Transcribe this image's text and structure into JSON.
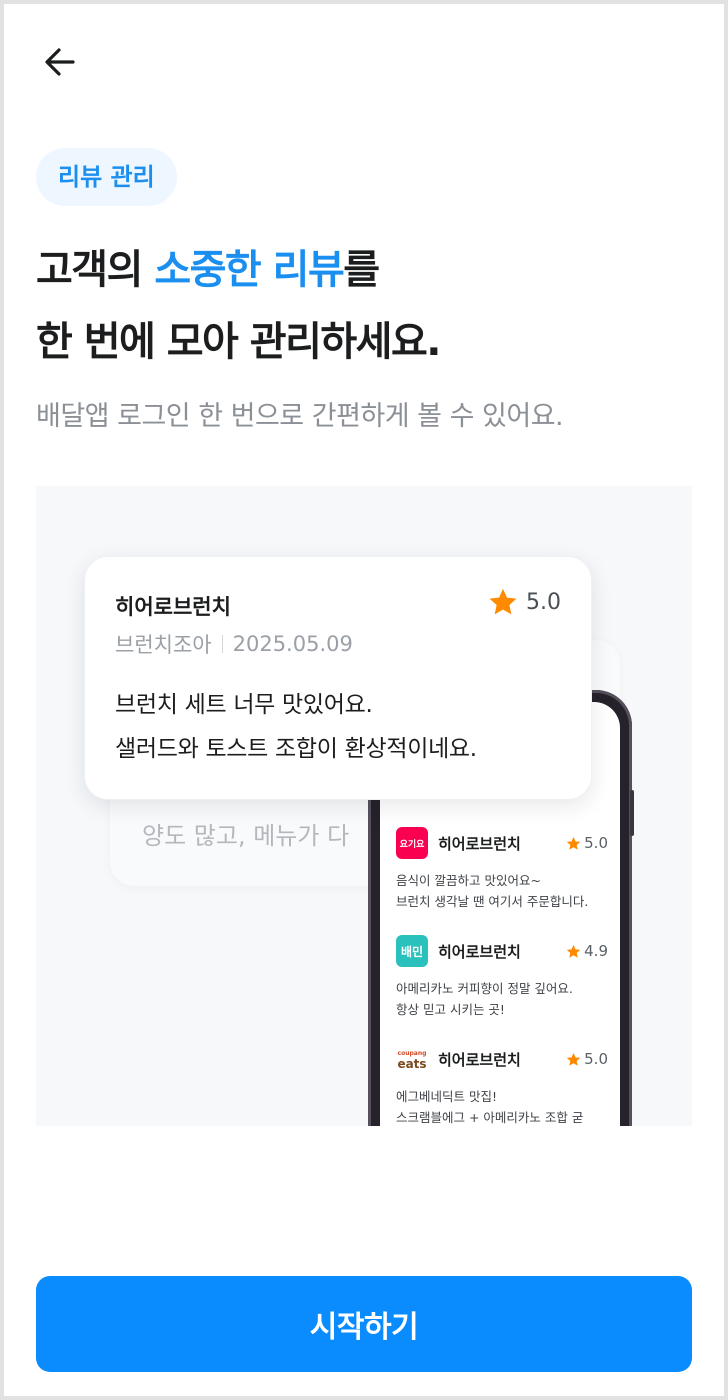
{
  "header": {
    "back_icon": "arrow-left-icon"
  },
  "badge": {
    "label": "리뷰 관리"
  },
  "headline": {
    "line1_prefix": "고객의 ",
    "line1_accent": "소중한 리뷰",
    "line1_suffix": "를",
    "line2": "한 번에 모아 관리하세요."
  },
  "subtitle": "배달앱 로그인 한 번으로 간편하게 볼 수 있어요.",
  "featured_review": {
    "store": "히어로브런치",
    "rating": "5.0",
    "author": "브런치조아",
    "date": "2025.05.09",
    "line1": "브런치 세트 너무 맛있어요.",
    "line2": "샐러드와 토스트 조합이 환상적이네요."
  },
  "back_card": {
    "text": "양도 많고, 메뉴가 다"
  },
  "phone_reviews": [
    {
      "app_logo_text": "요기요",
      "store": "히어로브런치",
      "rating": "5.0",
      "line1": "음식이 깔끔하고 맛있어요~",
      "line2": "브런치 생각날 땐 여기서 주문합니다."
    },
    {
      "app_logo_text": "배민",
      "store": "히어로브런치",
      "rating": "4.9",
      "line1": "아메리카노 커피향이 정말 깊어요.",
      "line2": "항상 믿고 시키는 곳!"
    },
    {
      "app_logo_text": "eats",
      "app_logo_subtext": "coupang",
      "store": "히어로브런치",
      "rating": "5.0",
      "line1": "에그베네딕트 맛집!",
      "line2": "스크램블에그 + 아메리카노 조합 굳"
    }
  ],
  "colors": {
    "accent": "#1b8ff0",
    "button": "#0a8cff",
    "star": "#ff8a00"
  },
  "cta": {
    "label": "시작하기"
  }
}
